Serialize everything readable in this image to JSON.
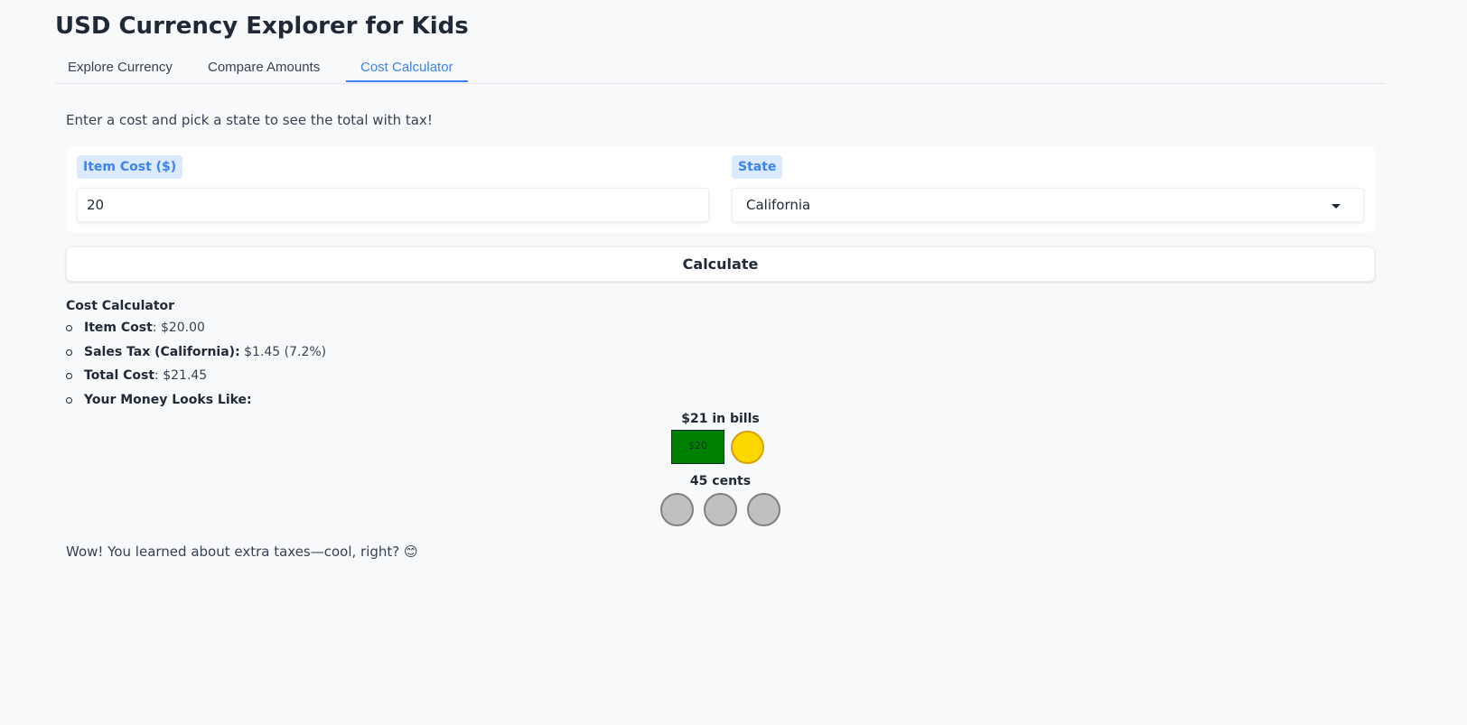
{
  "app": {
    "title": "USD Currency Explorer for Kids"
  },
  "tabs": [
    {
      "label": "Explore Currency",
      "active": false
    },
    {
      "label": "Compare Amounts",
      "active": false
    },
    {
      "label": "Cost Calculator",
      "active": true
    }
  ],
  "calculator": {
    "intro": "Enter a cost and pick a state to see the total with tax!",
    "item_cost": {
      "label": "Item Cost ($)",
      "value": "20"
    },
    "state": {
      "label": "State",
      "selected": "California"
    },
    "calculate_label": "Calculate"
  },
  "result": {
    "heading": "Cost Calculator",
    "items": [
      {
        "label": "Item Cost",
        "sep": ": ",
        "value": "$20.00"
      },
      {
        "label": "Sales Tax (California):",
        "sep": " ",
        "value": "$1.45 (7.2%)"
      },
      {
        "label": "Total Cost",
        "sep": ": ",
        "value": "$21.45"
      },
      {
        "label": "Your Money Looks Like:",
        "sep": "",
        "value": ""
      }
    ],
    "bills_title": "$21 in bills",
    "bill_label": "$20",
    "cents_title": "45 cents",
    "closing": "Wow! You learned about extra taxes—cool, right? 😊"
  },
  "colors": {
    "accent": "#3b82f6",
    "bill_green": "#008000",
    "dollar_coin": "#ffd700",
    "quarter_coin": "#c0c0c0"
  },
  "icons": {
    "select_caret": "chevron-down-icon"
  }
}
